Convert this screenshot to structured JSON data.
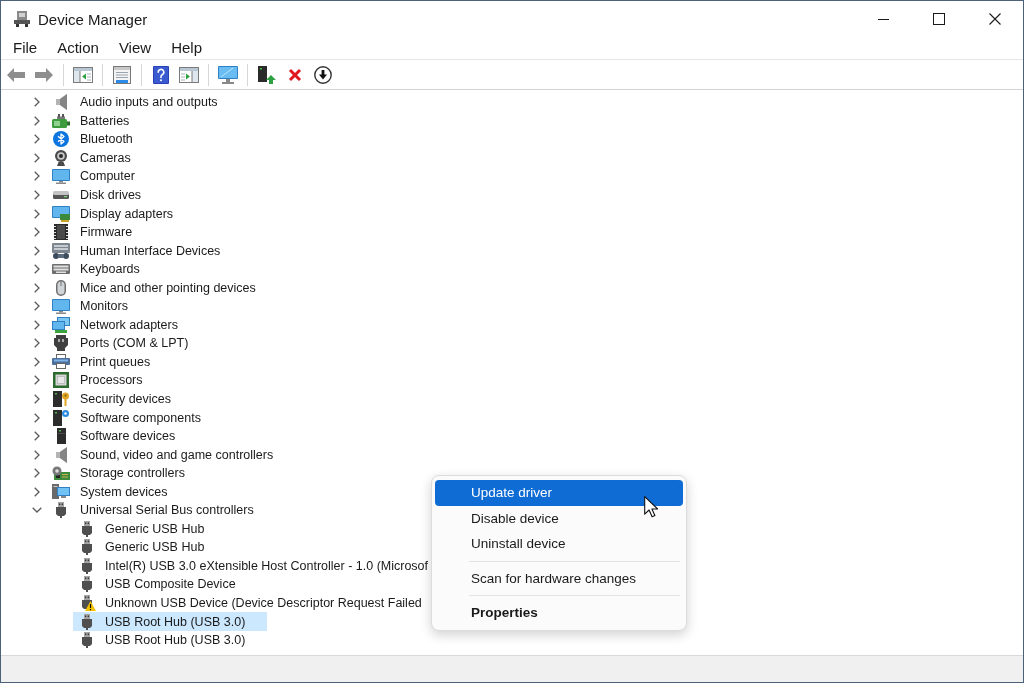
{
  "window": {
    "title": "Device Manager"
  },
  "menu_bar": [
    "File",
    "Action",
    "View",
    "Help"
  ],
  "toolbar": [
    [
      {
        "kind": "back",
        "disabled": true
      },
      {
        "kind": "forward",
        "disabled": true
      }
    ],
    [
      {
        "kind": "pane_window",
        "disabled": false
      }
    ],
    [
      {
        "kind": "sheet",
        "disabled": false
      }
    ],
    [
      {
        "kind": "help",
        "disabled": false
      },
      {
        "kind": "arrow_window",
        "disabled": false
      }
    ],
    [
      {
        "kind": "monitor",
        "disabled": false
      }
    ],
    [
      {
        "kind": "tower_arrow",
        "disabled": false
      },
      {
        "kind": "cross",
        "disabled": false
      },
      {
        "kind": "circle_arrow",
        "disabled": false
      }
    ]
  ],
  "tree": {
    "items": [
      {
        "label": "Audio inputs and outputs",
        "kind": "audio",
        "expanded": false,
        "selected": false
      },
      {
        "label": "Batteries",
        "kind": "battery",
        "expanded": false,
        "selected": false
      },
      {
        "label": "Bluetooth",
        "kind": "bluetooth",
        "expanded": false,
        "selected": false
      },
      {
        "label": "Cameras",
        "kind": "camera",
        "expanded": false,
        "selected": false
      },
      {
        "label": "Computer",
        "kind": "computer",
        "expanded": false,
        "selected": false
      },
      {
        "label": "Disk drives",
        "kind": "disk",
        "expanded": false,
        "selected": false
      },
      {
        "label": "Display adapters",
        "kind": "display",
        "expanded": false,
        "selected": false
      },
      {
        "label": "Firmware",
        "kind": "firmware",
        "expanded": false,
        "selected": false
      },
      {
        "label": "Human Interface Devices",
        "kind": "hid",
        "expanded": false,
        "selected": false
      },
      {
        "label": "Keyboards",
        "kind": "keyboard",
        "expanded": false,
        "selected": false
      },
      {
        "label": "Mice and other pointing devices",
        "kind": "mouse",
        "expanded": false,
        "selected": false
      },
      {
        "label": "Monitors",
        "kind": "monitor",
        "expanded": false,
        "selected": false
      },
      {
        "label": "Network adapters",
        "kind": "network",
        "expanded": false,
        "selected": false
      },
      {
        "label": "Ports (COM & LPT)",
        "kind": "port",
        "expanded": false,
        "selected": false
      },
      {
        "label": "Print queues",
        "kind": "printer",
        "expanded": false,
        "selected": false
      },
      {
        "label": "Processors",
        "kind": "processor",
        "expanded": false,
        "selected": false
      },
      {
        "label": "Security devices",
        "kind": "security",
        "expanded": false,
        "selected": false
      },
      {
        "label": "Software components",
        "kind": "software_component",
        "expanded": false,
        "selected": false
      },
      {
        "label": "Software devices",
        "kind": "software_device",
        "expanded": false,
        "selected": false
      },
      {
        "label": "Sound, video and game controllers",
        "kind": "sound",
        "expanded": false,
        "selected": false
      },
      {
        "label": "Storage controllers",
        "kind": "storage",
        "expanded": false,
        "selected": false
      },
      {
        "label": "System devices",
        "kind": "system",
        "expanded": false,
        "selected": false
      },
      {
        "label": "Universal Serial Bus controllers",
        "kind": "usb",
        "expanded": true,
        "selected": false,
        "children": [
          {
            "label": "Generic USB Hub",
            "kind": "usb",
            "warning": false,
            "selected": false
          },
          {
            "label": "Generic USB Hub",
            "kind": "usb",
            "warning": false,
            "selected": false
          },
          {
            "label": "Intel(R) USB 3.0 eXtensible Host Controller - 1.0 (Microsof",
            "kind": "usb",
            "warning": false,
            "selected": false
          },
          {
            "label": "USB Composite Device",
            "kind": "usb",
            "warning": false,
            "selected": false
          },
          {
            "label": "Unknown USB Device (Device Descriptor Request Failed",
            "kind": "usb",
            "warning": true,
            "selected": false
          },
          {
            "label": "USB Root Hub (USB 3.0)",
            "kind": "usb",
            "warning": false,
            "selected": true
          },
          {
            "label": "USB Root Hub (USB 3.0)",
            "kind": "usb",
            "warning": false,
            "selected": false
          }
        ]
      }
    ]
  },
  "context_menu": {
    "groups": [
      [
        {
          "label": "Update driver",
          "selected": true,
          "default": false
        },
        {
          "label": "Disable device",
          "selected": false,
          "default": false
        },
        {
          "label": "Uninstall device",
          "selected": false,
          "default": false
        }
      ],
      [
        {
          "label": "Scan for hardware changes",
          "selected": false,
          "default": false
        }
      ],
      [
        {
          "label": "Properties",
          "selected": false,
          "default": true
        }
      ]
    ]
  }
}
